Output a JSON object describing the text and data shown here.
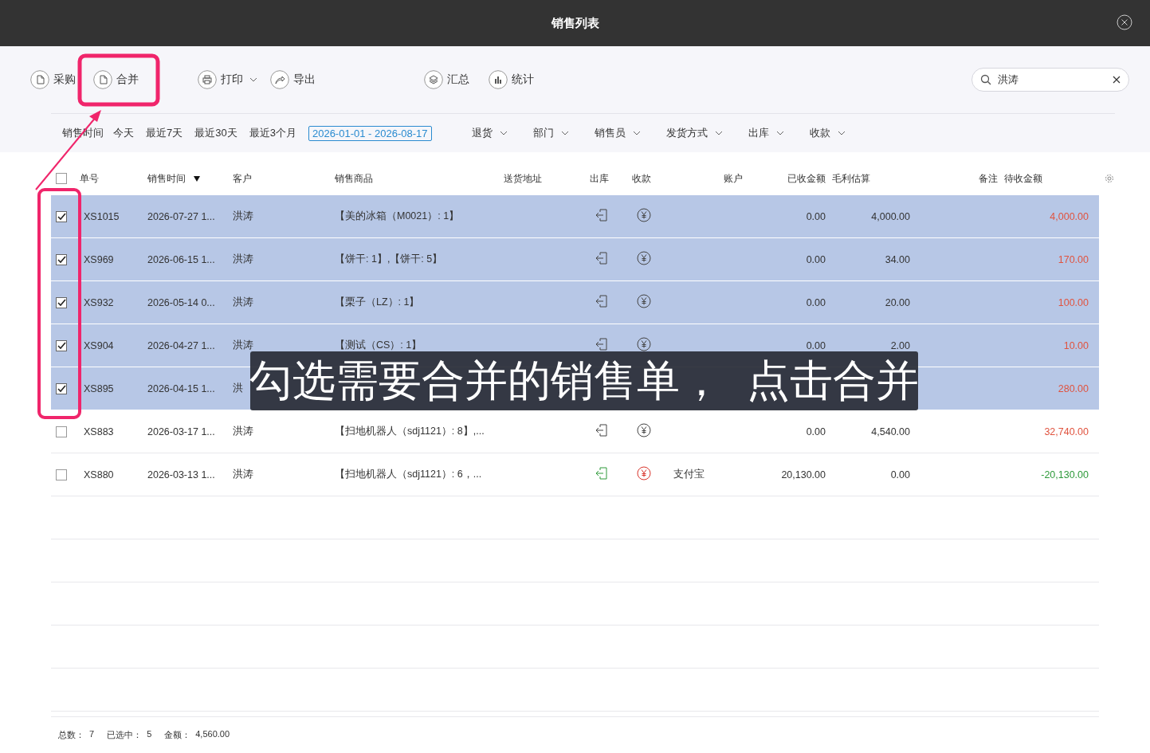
{
  "window": {
    "title": "销售列表"
  },
  "toolbar": [
    {
      "label": "采购",
      "has_menu": false
    },
    {
      "label": "合并",
      "has_menu": false
    },
    {
      "label": "打印",
      "has_menu": true
    },
    {
      "label": "导出",
      "has_menu": false
    },
    {
      "label": "汇总",
      "has_menu": false
    },
    {
      "label": "统计",
      "has_menu": false
    }
  ],
  "search": {
    "value": "洪涛"
  },
  "filters": {
    "label": "销售时间",
    "quick": [
      "今天",
      "最近7天",
      "最近30天",
      "最近3个月"
    ],
    "date_range": "2026-01-01 - 2026-08-17",
    "dropdowns": [
      "退货",
      "部门",
      "销售员",
      "发货方式",
      "出库",
      "收款"
    ]
  },
  "table": {
    "all_checked": false,
    "columns": [
      {
        "label": "单号",
        "sorted": false
      },
      {
        "label": "销售时间",
        "sorted": true
      },
      {
        "label": "客户",
        "sorted": false
      },
      {
        "label": "销售商品",
        "sorted": false
      },
      {
        "label": "送货地址",
        "sorted": false
      },
      {
        "label": "出库",
        "sorted": false
      },
      {
        "label": "收款",
        "sorted": false
      },
      {
        "label": "账户",
        "sorted": false
      },
      {
        "label": "已收金额",
        "sorted": false
      },
      {
        "label": "毛利估算",
        "sorted": false
      },
      {
        "label": "备注",
        "sorted": false
      },
      {
        "label": "待收金额",
        "sorted": false
      }
    ],
    "rows": [
      {
        "checked": true,
        "number": "XS1015",
        "time": "2026-07-27 1...",
        "customer": "洪涛",
        "goods": "【美的冰箱（M0021）: 1】",
        "shipped": false,
        "settled": false,
        "received": "0.00",
        "profit": "4,000.00",
        "pending": "4,000.00",
        "color": "#e0533f"
      },
      {
        "checked": true,
        "number": "XS969",
        "time": "2026-06-15 1...",
        "customer": "洪涛",
        "goods": "【饼干: 1】,【饼干: 5】",
        "shipped": false,
        "settled": false,
        "received": "0.00",
        "profit": "34.00",
        "pending": "170.00",
        "color": "#e0533f"
      },
      {
        "checked": true,
        "number": "XS932",
        "time": "2026-05-14 0...",
        "customer": "洪涛",
        "goods": "【栗子（LZ）: 1】",
        "shipped": false,
        "settled": false,
        "received": "0.00",
        "profit": "20.00",
        "pending": "100.00",
        "color": "#e0533f"
      },
      {
        "checked": true,
        "number": "XS904",
        "time": "2026-04-27 1...",
        "customer": "洪涛",
        "goods": "【测试（CS）: 1】",
        "shipped": false,
        "settled": false,
        "received": "0.00",
        "profit": "2.00",
        "pending": "10.00",
        "color": "#e0533f"
      },
      {
        "checked": true,
        "number": "XS895",
        "time": "2026-04-15 1...",
        "customer": "洪",
        "pending": "280.00",
        "color": "#e0533f"
      },
      {
        "checked": false,
        "number": "XS883",
        "time": "2026-03-17 1...",
        "customer": "洪涛",
        "goods": "【扫地机器人（sdj1121）: 8】,...",
        "shipped": false,
        "settled": false,
        "received": "0.00",
        "profit": "4,540.00",
        "pending": "32,740.00",
        "color": "#e0533f"
      },
      {
        "checked": false,
        "number": "XS880",
        "time": "2026-03-13 1...",
        "customer": "洪涛",
        "goods": "【扫地机器人（sdj1121）: 6，...",
        "shipped": true,
        "settled": true,
        "account": "支付宝",
        "received": "20,130.00",
        "profit": "0.00",
        "pending": "-20,130.00",
        "color": "#2e9a3a"
      }
    ]
  },
  "footer": [
    {
      "label": "总数：",
      "value": "7"
    },
    {
      "label": "已选中：",
      "value": "5"
    },
    {
      "label": "金额：",
      "value": "4,560.00"
    }
  ],
  "caption": "勾选需要合并的销售单，  点击合并"
}
